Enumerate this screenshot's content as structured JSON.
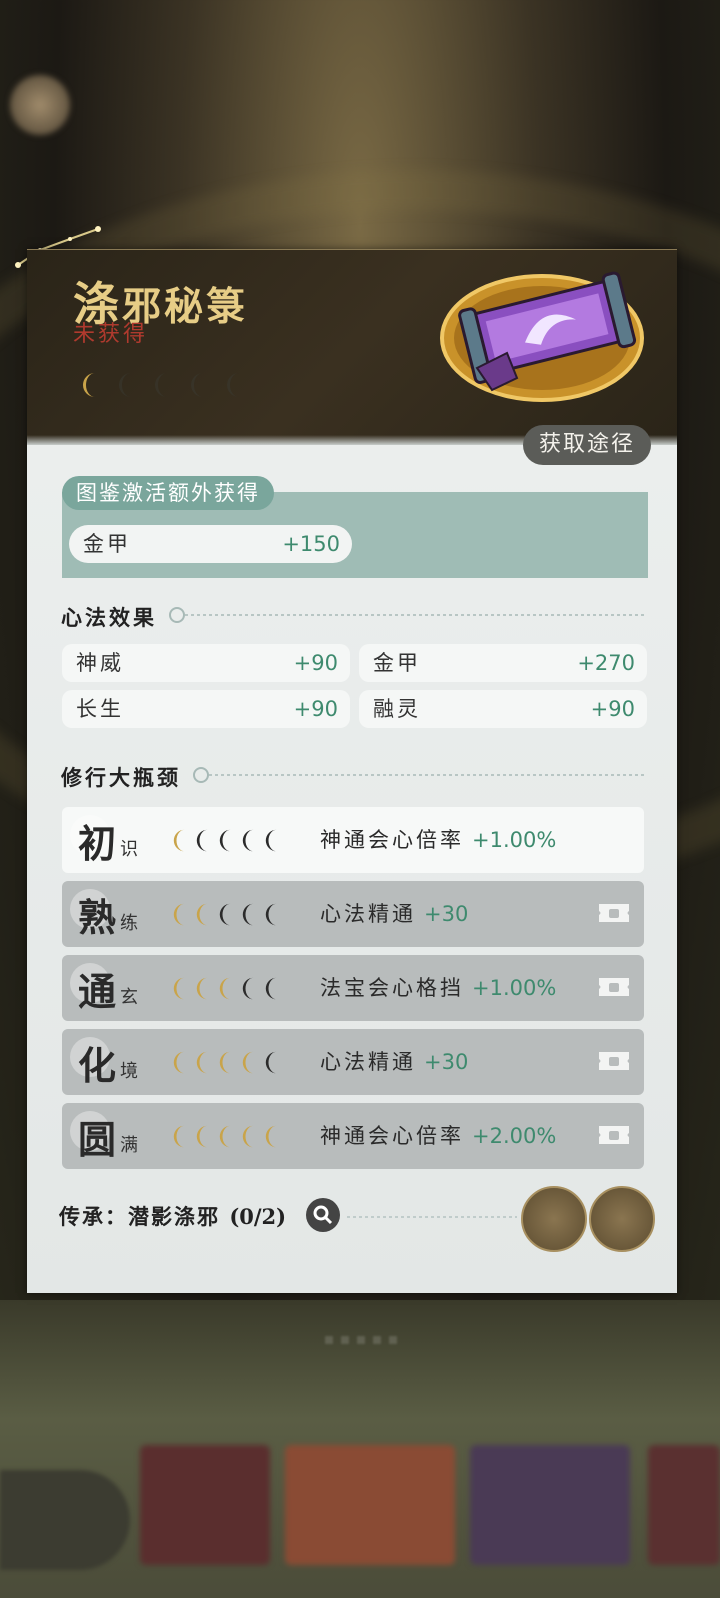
{
  "item": {
    "name_first": "涤",
    "name_rest": "邪秘箓",
    "status": "未获得",
    "stars_filled": 1,
    "stars_total": 5
  },
  "source_button": "获取途径",
  "extra": {
    "tag": "图鉴激活额外获得",
    "stat_label": "金甲",
    "stat_value": "+150"
  },
  "effects": {
    "title": "心法效果",
    "stats": [
      {
        "label": "神威",
        "value": "+90"
      },
      {
        "label": "金甲",
        "value": "+270"
      },
      {
        "label": "长生",
        "value": "+90"
      },
      {
        "label": "融灵",
        "value": "+90"
      }
    ]
  },
  "bottleneck": {
    "title": "修行大瓶颈",
    "stages": [
      {
        "char": "初",
        "sub": "识",
        "moons": 1,
        "effect": "神通会心倍率",
        "value": "+1.00%",
        "locked": false
      },
      {
        "char": "熟",
        "sub": "练",
        "moons": 2,
        "effect": "心法精通",
        "value": "+30",
        "locked": true
      },
      {
        "char": "通",
        "sub": "玄",
        "moons": 3,
        "effect": "法宝会心格挡",
        "value": "+1.00%",
        "locked": true
      },
      {
        "char": "化",
        "sub": "境",
        "moons": 4,
        "effect": "心法精通",
        "value": "+30",
        "locked": true
      },
      {
        "char": "圆",
        "sub": "满",
        "moons": 5,
        "effect": "神通会心倍率",
        "value": "+2.00%",
        "locked": true
      }
    ]
  },
  "inherit": {
    "label": "传承：潜影涤邪",
    "count": "(0/2)"
  },
  "colors": {
    "gold_moon": "#c9a44a",
    "dark_moon": "#2b2b2b",
    "accent_green": "#3e8a6e",
    "status_red": "#b03a2e",
    "title_gold": "#e7cd86"
  }
}
